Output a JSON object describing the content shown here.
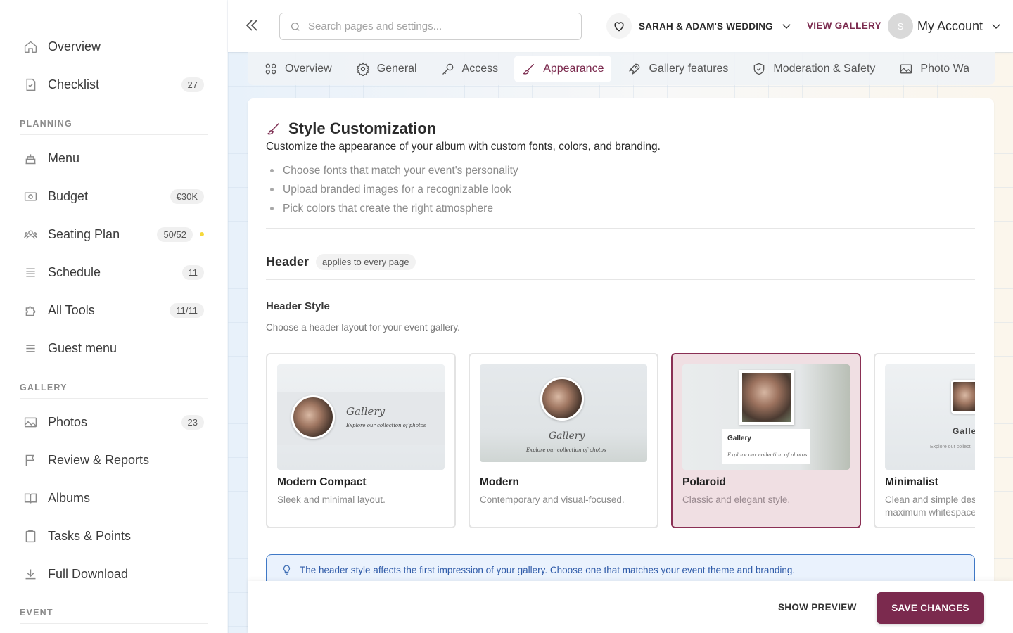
{
  "sidebar": {
    "items_top": [
      {
        "label": "Overview",
        "icon": "home-icon"
      },
      {
        "label": "Checklist",
        "icon": "checklist-icon",
        "badge": "27"
      }
    ],
    "sections": [
      "PLANNING",
      "GALLERY",
      "EVENT"
    ],
    "planning": [
      {
        "label": "Menu",
        "icon": "cake-icon"
      },
      {
        "label": "Budget",
        "icon": "money-icon",
        "badge": "€30K"
      },
      {
        "label": "Seating Plan",
        "icon": "people-icon",
        "badge": "50/52"
      },
      {
        "label": "Schedule",
        "icon": "list-icon",
        "badge": "11"
      },
      {
        "label": "All Tools",
        "icon": "puzzle-icon",
        "badge": "11/11"
      },
      {
        "label": "Guest menu",
        "icon": "menu-icon"
      }
    ],
    "gallery": [
      {
        "label": "Photos",
        "icon": "image-icon",
        "badge": "23"
      },
      {
        "label": "Review & Reports",
        "icon": "flag-icon"
      },
      {
        "label": "Albums",
        "icon": "book-icon"
      },
      {
        "label": "Tasks & Points",
        "icon": "clipboard-icon"
      },
      {
        "label": "Full Download",
        "icon": "download-icon"
      }
    ]
  },
  "topbar": {
    "search_placeholder": "Search pages and settings...",
    "event_name": "SARAH & ADAM'S WEDDING",
    "view_gallery": "VIEW GALLERY",
    "avatar_initial": "S",
    "account_label": "My Account"
  },
  "tabs": [
    {
      "label": "Overview",
      "icon": "grid-icon"
    },
    {
      "label": "General",
      "icon": "gear-icon"
    },
    {
      "label": "Access",
      "icon": "key-icon"
    },
    {
      "label": "Appearance",
      "icon": "brush-icon",
      "active": true
    },
    {
      "label": "Gallery features",
      "icon": "rocket-icon"
    },
    {
      "label": "Moderation & Safety",
      "icon": "shield-icon"
    },
    {
      "label": "Photo Wa",
      "icon": "image-icon"
    }
  ],
  "style_customization": {
    "title": "Style Customization",
    "description": "Customize the appearance of your album with custom fonts, colors, and branding.",
    "bullets": [
      "Choose fonts that match your event's personality",
      "Upload branded images for a recognizable look",
      "Pick colors that create the right atmosphere"
    ]
  },
  "header_section": {
    "title": "Header",
    "chip": "applies to every page",
    "style_title": "Header Style",
    "style_desc": "Choose a header layout for your event gallery."
  },
  "header_options": [
    {
      "name": "Modern Compact",
      "desc": "Sleek and minimal layout.",
      "thumb_title": "Gallery",
      "thumb_sub": "Explore our collection of photos"
    },
    {
      "name": "Modern",
      "desc": "Contemporary and visual-focused.",
      "thumb_title": "Gallery",
      "thumb_sub": "Explore our collection of photos"
    },
    {
      "name": "Polaroid",
      "desc": "Classic and elegant style.",
      "thumb_title": "Gallery",
      "thumb_sub": "Explore our collection of photos",
      "selected": true
    },
    {
      "name": "Minimalist",
      "desc": "Clean and simple des maximum whitespace",
      "thumb_title": "Galle",
      "thumb_sub": "Explore our collect"
    }
  ],
  "info_banner": "The header style affects the first impression of your gallery. Choose one that matches your event theme and branding.",
  "footer": {
    "preview": "SHOW PREVIEW",
    "save": "SAVE CHANGES"
  },
  "colors": {
    "accent": "#7b2a4e",
    "selected_card_bg": "#f0dfe3",
    "info_text": "#2e5aa8",
    "seating_dot": "#f5d83a"
  }
}
